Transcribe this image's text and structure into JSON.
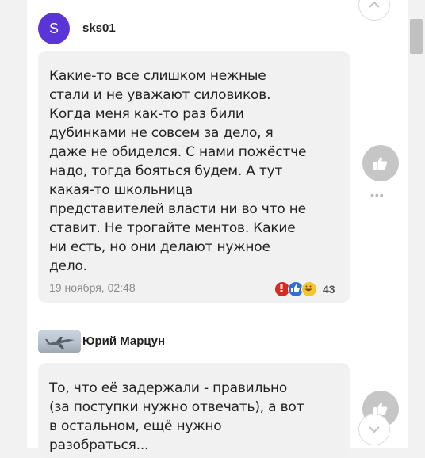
{
  "comments": [
    {
      "avatar_letter": "S",
      "username": "sks01",
      "text_lines": [
        "Какие-то все слишком нежные",
        "стали и не уважают силовиков.",
        "Когда меня как-то раз били",
        "дубинками не совсем за дело, я",
        "даже не обиделся. С нами пожёстче",
        "надо, тогда бояться будем. А тут",
        "какая-то школьница",
        "представителей власти ни во что не",
        "ставит. Не трогайте ментов. Какие",
        "ни есть, но они делают нужное",
        "дело."
      ],
      "timestamp": "19 ноября, 02:48",
      "reaction_count": "43",
      "more_dots": "•••"
    },
    {
      "username": "Юрий Марцун",
      "text_lines": [
        "То, что её задержали - правильно",
        "(за поступки нужно отвечать), а вот",
        "в остальном, ещё нужно",
        "разобраться..."
      ]
    }
  ],
  "colors": {
    "avatar_bg": "#5b34d8",
    "bubble_bg": "#f1f1f1",
    "like_button": "#c6c6c6"
  },
  "icons": {
    "like": "thumbs-up-icon",
    "scroll_up": "chevron-up-icon",
    "scroll_down": "chevron-down-icon",
    "reactions": [
      "angry-reaction-icon",
      "like-reaction-icon",
      "haha-reaction-icon"
    ]
  }
}
